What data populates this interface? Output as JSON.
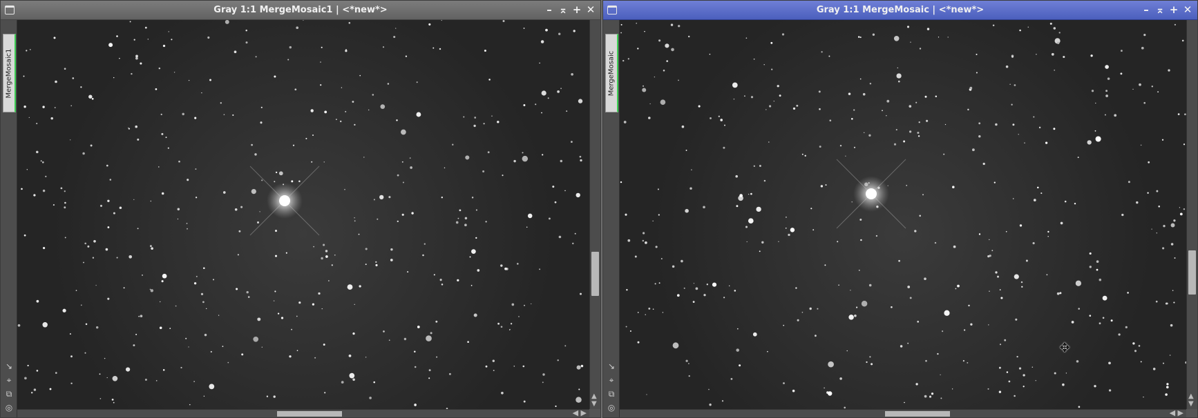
{
  "windows": [
    {
      "title": "Gray 1:1 MergeMosaic1 | <*new*>",
      "view_tab": "MergeMosaic1",
      "active": false,
      "buttons": [
        "–",
        "⌅",
        "+",
        "✕"
      ]
    },
    {
      "title": "Gray 1:1 MergeMosaic | <*new*>",
      "view_tab": "MergeMosaic",
      "active": true,
      "buttons": [
        "–",
        "⌅",
        "+",
        "✕"
      ]
    }
  ],
  "colors": {
    "active_title": "#4b5fbd",
    "inactive_title": "#6a6a6a",
    "view_tab_accent": "#3ccf53",
    "image_background": "#2b2b2b"
  },
  "icons": {
    "window_menu": "window-icon",
    "minimize": "minimize-icon",
    "shade": "shade-icon",
    "maximize": "maximize-icon",
    "close": "close-icon",
    "cursor": "pan-cursor-icon"
  }
}
